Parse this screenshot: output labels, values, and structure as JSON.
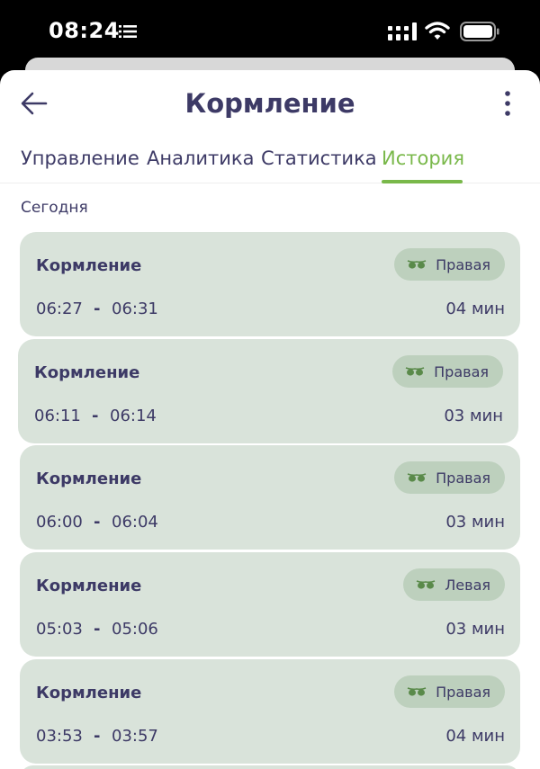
{
  "status_bar": {
    "time": "08:24",
    "icons": [
      "list-icon",
      "signal-icon",
      "wifi-icon",
      "battery-icon"
    ]
  },
  "header": {
    "title": "Кормление",
    "back_icon": "arrow-left-icon",
    "more_icon": "more-vertical-icon"
  },
  "tabs": [
    {
      "label": "Управление",
      "active": false
    },
    {
      "label": "Аналитика",
      "active": false
    },
    {
      "label": "Статистика",
      "active": false
    },
    {
      "label": "История",
      "active": true
    }
  ],
  "section": {
    "title": "Сегодня"
  },
  "entries": [
    {
      "title": "Кормление",
      "side": "Правая",
      "start": "06:27",
      "separator": "-",
      "end": "06:31",
      "duration": "04 мин"
    },
    {
      "title": "Кормление",
      "side": "Правая",
      "start": "06:11",
      "separator": "-",
      "end": "06:14",
      "duration": "03 мин"
    },
    {
      "title": "Кормление",
      "side": "Правая",
      "start": "06:00",
      "separator": "-",
      "end": "06:04",
      "duration": "03 мин"
    },
    {
      "title": "Кормление",
      "side": "Левая",
      "start": "05:03",
      "separator": "-",
      "end": "05:06",
      "duration": "03 мин"
    },
    {
      "title": "Кормление",
      "side": "Правая",
      "start": "03:53",
      "separator": "-",
      "end": "03:57",
      "duration": "04 мин"
    }
  ],
  "colors": {
    "primary_text": "#3d3a66",
    "accent": "#79b84a",
    "card_background": "#d9e3da",
    "badge_background": "#bdd0bd",
    "badge_icon": "#5a8a4a"
  }
}
